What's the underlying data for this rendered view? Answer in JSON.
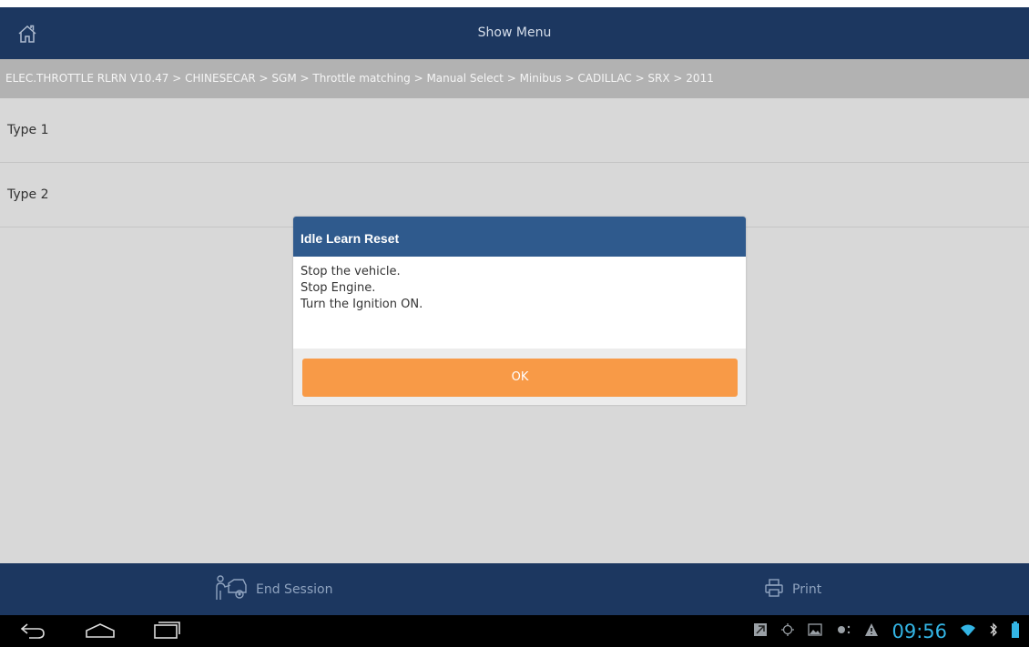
{
  "header": {
    "title": "Show Menu",
    "home_icon": "home-icon"
  },
  "breadcrumb": "ELEC.THROTTLE RLRN V10.47 > CHINESECAR > SGM > Throttle matching > Manual Select > Minibus > CADILLAC > SRX > 2011",
  "menu": {
    "items": [
      {
        "label": "Type 1"
      },
      {
        "label": "Type 2"
      }
    ]
  },
  "dialog": {
    "title": "Idle Learn Reset",
    "lines": [
      "Stop the vehicle.",
      "Stop Engine.",
      "Turn the Ignition ON."
    ],
    "ok_label": "OK"
  },
  "footer": {
    "end_session_label": "End Session",
    "end_session_icon": "mechanic-icon",
    "print_label": "Print",
    "print_icon": "printer-icon"
  },
  "system_bar": {
    "time": "09:56",
    "icons": [
      "back-icon",
      "home-icon",
      "recent-apps-icon",
      "app-notification-icon",
      "gps-icon",
      "image-icon",
      "sync-icon",
      "warning-icon",
      "wifi-icon",
      "bluetooth-icon",
      "battery-icon"
    ]
  },
  "colors": {
    "header_bg": "#1c3760",
    "dialog_title_bg": "#2f5a8d",
    "ok_button": "#f89a47",
    "clock": "#33b5e5"
  }
}
